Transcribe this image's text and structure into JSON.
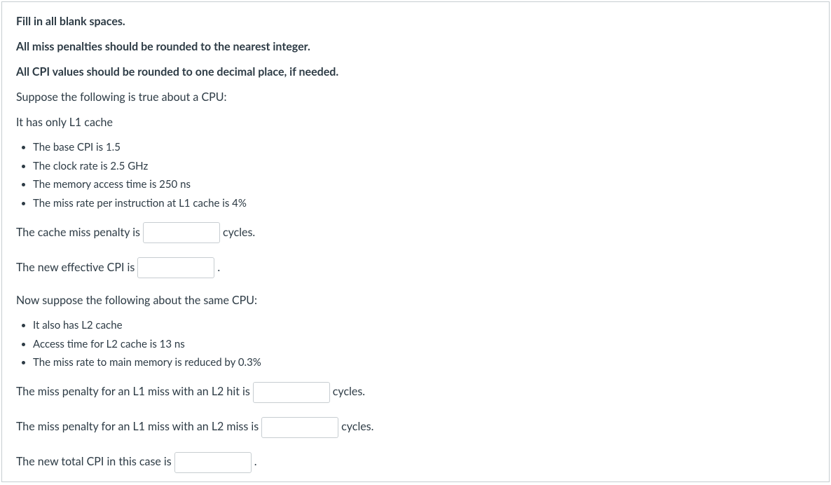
{
  "instructions": {
    "line1": "Fill in all blank spaces.",
    "line2": "All miss penalties should be rounded to the nearest integer.",
    "line3": "All CPI values should be rounded to one decimal place, if needed."
  },
  "section1": {
    "intro1": "Suppose the following is true about a CPU:",
    "intro2": "It has only L1 cache",
    "bullets": [
      "The base CPI is 1.5",
      "The clock rate is 2.5 GHz",
      "The memory access time is 250 ns",
      "The miss rate per instruction at L1 cache is 4%"
    ],
    "q1_before": "The cache miss penalty is",
    "q1_after": "cycles.",
    "q2_before": "The new effective CPI is",
    "q2_after": "."
  },
  "section2": {
    "intro": "Now suppose the following about the same CPU:",
    "bullets": [
      "It also has L2 cache",
      "Access time for L2 cache is 13 ns",
      "The miss rate to main memory is reduced by 0.3%"
    ],
    "q3_before": "The miss penalty for an L1 miss with an L2 hit is",
    "q3_after": "cycles.",
    "q4_before": "The miss penalty for an L1 miss with an L2 miss is",
    "q4_after": "cycles.",
    "q5_before": "The new total CPI in this case is",
    "q5_after": "."
  }
}
